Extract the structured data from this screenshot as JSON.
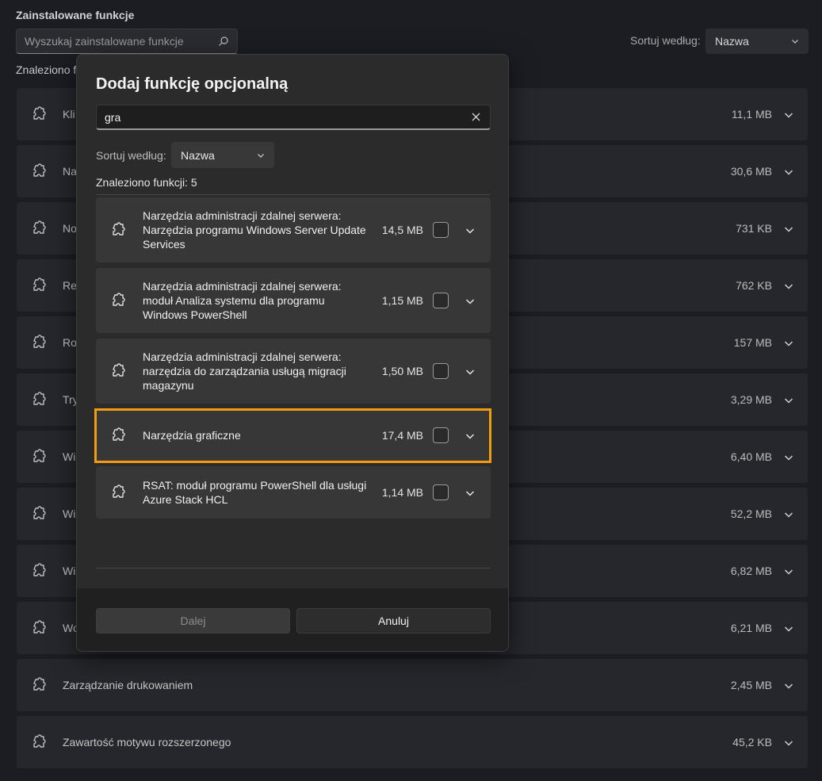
{
  "background": {
    "title": "Zainstalowane funkcje",
    "search_placeholder": "Wyszukaj zainstalowane funkcje",
    "sort_label": "Sortuj według:",
    "sort_value": "Nazwa",
    "found_text": "Znaleziono f",
    "rows": [
      {
        "name": "Kli",
        "size": "11,1 MB"
      },
      {
        "name": "Na",
        "size": "30,6 MB"
      },
      {
        "name": "No",
        "size": "731 KB"
      },
      {
        "name": "Rej",
        "size": "762 KB"
      },
      {
        "name": "Ro",
        "size": "157 MB"
      },
      {
        "name": "Try",
        "size": "3,29 MB"
      },
      {
        "name": "Wi",
        "size": "6,40 MB"
      },
      {
        "name": "Wi",
        "size": "52,2 MB"
      },
      {
        "name": "Wi",
        "size": "6,82 MB"
      },
      {
        "name": "Wo",
        "size": "6,21 MB"
      },
      {
        "name": "Zarządzanie drukowaniem",
        "size": "2,45 MB"
      },
      {
        "name": "Zawartość motywu rozszerzonego",
        "size": "45,2 KB"
      }
    ]
  },
  "dialog": {
    "title": "Dodaj funkcję opcjonalną",
    "search_value": "gra",
    "sort_label": "Sortuj według:",
    "sort_value": "Nazwa",
    "found_text": "Znaleziono funkcji: 5",
    "features": [
      {
        "name": "Narzędzia administracji zdalnej serwera:\nNarzędzia programu Windows Server Update\nServices",
        "size": "14,5 MB",
        "checked": false
      },
      {
        "name": "Narzędzia administracji zdalnej serwera:\nmoduł Analiza systemu dla programu\nWindows PowerShell",
        "size": "1,15 MB",
        "checked": false
      },
      {
        "name": "Narzędzia administracji zdalnej serwera:\nnarzędzia do zarządzania usługą migracji\nmagazynu",
        "size": "1,50 MB",
        "checked": false
      },
      {
        "name": "Narzędzia graficzne",
        "size": "17,4 MB",
        "checked": false,
        "highlighted": true
      },
      {
        "name": "RSAT: moduł programu PowerShell dla usługi\nAzure Stack HCL",
        "size": "1,14 MB",
        "checked": false
      }
    ],
    "next_label": "Dalej",
    "cancel_label": "Anuluj"
  },
  "colors": {
    "highlight": "#f39c12",
    "page_bg": "#1b1d23",
    "dialog_bg": "#2b2b2b"
  },
  "icons": {
    "feature": "puzzle-icon",
    "expand": "chevron-down-icon",
    "search": "search-icon",
    "clear": "close-icon"
  }
}
